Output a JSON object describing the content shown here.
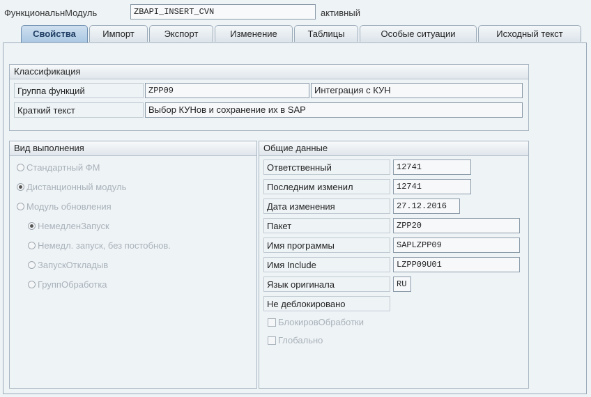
{
  "header": {
    "label": "ФункциональнМодуль",
    "module_name": "ZBAPI_INSERT_CVN",
    "status": "активный"
  },
  "tabs": [
    {
      "label": "Свойства",
      "active": true
    },
    {
      "label": "Импорт",
      "active": false
    },
    {
      "label": "Экспорт",
      "active": false
    },
    {
      "label": "Изменение",
      "active": false
    },
    {
      "label": "Таблицы",
      "active": false
    },
    {
      "label": "Особые ситуации",
      "active": false
    },
    {
      "label": "Исходный текст",
      "active": false
    }
  ],
  "classification": {
    "title": "Классификация",
    "function_group_label": "Группа функций",
    "function_group_value": "ZPP09",
    "function_group_desc": "Интеграция с КУН",
    "short_text_label": "Краткий текст",
    "short_text_value": "Выбор КУНов и сохранение их в SAP"
  },
  "execution": {
    "title": "Вид выполнения",
    "options": [
      {
        "label": "Стандартный ФМ",
        "selected": false
      },
      {
        "label": "Дистанционный модуль",
        "selected": true
      },
      {
        "label": "Модуль обновления",
        "selected": false
      }
    ],
    "sub_options": [
      {
        "label": "НемедленЗапуск",
        "selected": true
      },
      {
        "label": "Немедл. запуск, без постобнов.",
        "selected": false
      },
      {
        "label": "ЗапускОткладыв",
        "selected": false
      },
      {
        "label": "ГруппОбработка",
        "selected": false
      }
    ]
  },
  "general": {
    "title": "Общие данные",
    "responsible_label": "Ответственный",
    "responsible_value": "12741",
    "last_changed_by_label": "Последним изменил",
    "last_changed_by_value": "12741",
    "change_date_label": "Дата изменения",
    "change_date_value": "27.12.2016",
    "package_label": "Пакет",
    "package_value": "ZPP20",
    "program_label": "Имя программы",
    "program_value": "SAPLZPP09",
    "include_label": "Имя Include",
    "include_value": "LZPP09U01",
    "language_label": "Язык оригинала",
    "language_value": "RU",
    "not_released_label": "Не деблокировано",
    "checkboxes": [
      {
        "label": "БлокировОбработки",
        "checked": false
      },
      {
        "label": "Глобально",
        "checked": false
      }
    ]
  }
}
